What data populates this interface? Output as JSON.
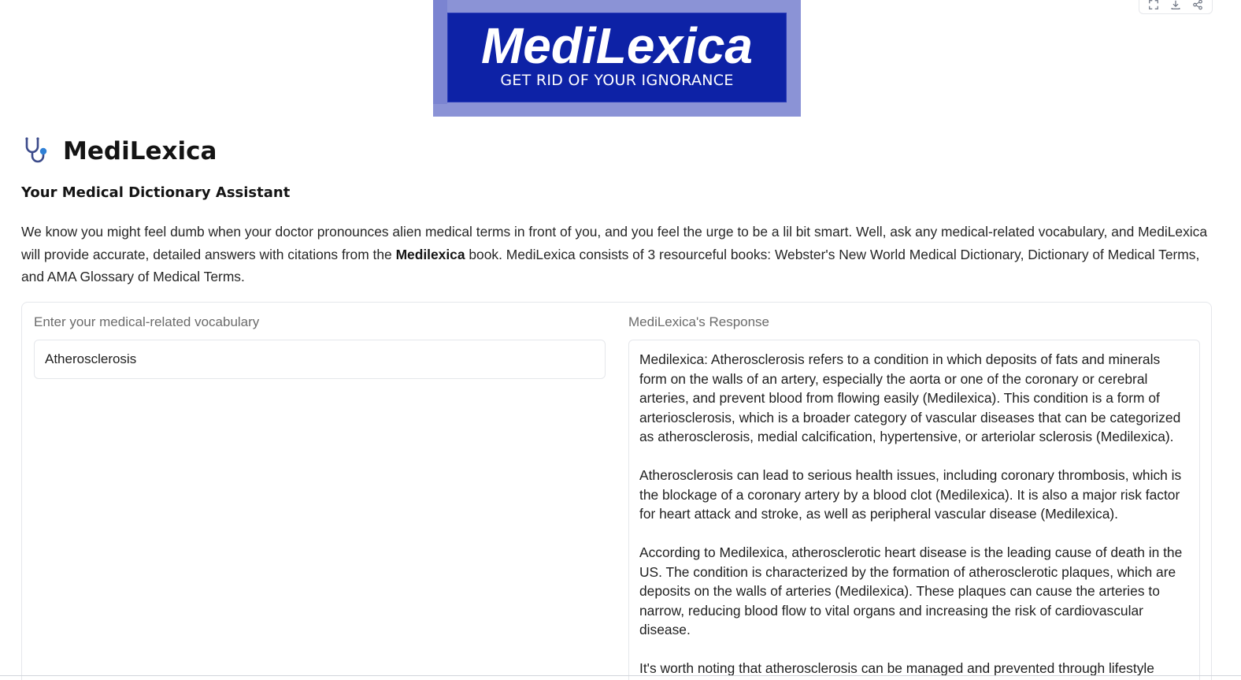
{
  "toolbar": {
    "icons": [
      "fullscreen-icon",
      "download-icon",
      "share-icon"
    ]
  },
  "logo": {
    "title": "MediLexica",
    "tagline": "GET RID OF YOUR IGNORANCE",
    "colors": {
      "front": "#0d22a6",
      "back": "#8b93d6"
    }
  },
  "header": {
    "icon": "stethoscope-icon",
    "title": "MediLexica",
    "subtitle": "Your Medical Dictionary Assistant"
  },
  "description": {
    "part1": "We know you might feel dumb when your doctor pronounces alien medical terms in front of you, and you feel the urge to be a lil bit smart. Well, ask any medical-related vocabulary, and MediLexica will provide accurate, detailed answers with citations from the ",
    "bold": "Medilexica",
    "part2": " book. MediLexica consists of 3 resourceful books: Webster's New World Medical Dictionary, Dictionary of Medical Terms, and AMA Glossary of Medical Terms."
  },
  "input": {
    "label": "Enter your medical-related vocabulary",
    "value": "Atherosclerosis"
  },
  "response": {
    "label": "MediLexica's Response",
    "paragraphs": [
      "Medilexica: Atherosclerosis refers to a condition in which deposits of fats and minerals form on the walls of an artery, especially the aorta or one of the coronary or cerebral arteries, and prevent blood from flowing easily (Medilexica). This condition is a form of arteriosclerosis, which is a broader category of vascular diseases that can be categorized as atherosclerosis, medial calcification, hypertensive, or arteriolar sclerosis (Medilexica).",
      "Atherosclerosis can lead to serious health issues, including coronary thrombosis, which is the blockage of a coronary artery by a blood clot (Medilexica). It is also a major risk factor for heart attack and stroke, as well as peripheral vascular disease (Medilexica).",
      "According to Medilexica, atherosclerotic heart disease is the leading cause of death in the US. The condition is characterized by the formation of atherosclerotic plaques, which are deposits on the walls of arteries (Medilexica). These plaques can cause the arteries to narrow, reducing blood flow to vital organs and increasing the risk of cardiovascular disease.",
      "It's worth noting that atherosclerosis can be managed and prevented through lifestyle"
    ]
  }
}
